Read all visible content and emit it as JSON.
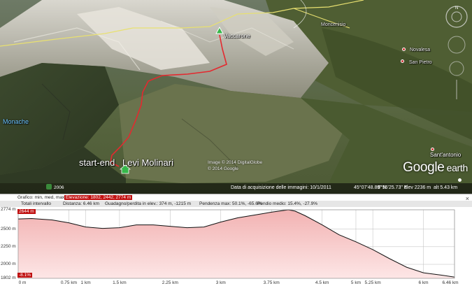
{
  "map": {
    "labels": {
      "moncenisio": "Moncenisio",
      "vaccarone": "Vaccarone",
      "novalesa": "Novalesa",
      "san_pietro": "San Pietro",
      "monache": "Monache",
      "sant_antonio": "Sant'antonio",
      "start_end": "start-end",
      "levi_molinari": "Levi Molinari"
    },
    "copyright": [
      "Image © 2014 DigitalGlobe",
      "© 2014 Google"
    ],
    "logo": {
      "google": "Google",
      "earth": "earth"
    },
    "year": "2006",
    "status": {
      "acquisition": "Data di acquisizione delle immagini: 10/1/2011",
      "lat": "45°07'48.89\" N",
      "lon": "6°55'25.73\" E",
      "elev": "elev  2236 m",
      "alt": "alt  5.43 km"
    },
    "colors": {
      "track": "#e4292f",
      "border": "#e8e070",
      "marker": "#36b84a"
    }
  },
  "profile": {
    "header": {
      "graph_label": "Grafico: min, med, max",
      "elevation_label": "Elevazione: 1802, 2442, 2774 m",
      "close": "×"
    },
    "stats": {
      "totals": "Totali intervallo",
      "distance": "Distanza: 6.46 km",
      "gain": "Guadagno/perdita in elev.: 374 m, -1215 m",
      "slope_max": "Pendenza max: 50.1%, -65.6%",
      "slope_avg": "Pendio medio: 15.4%, -27.9%"
    },
    "cursor_tags": {
      "top": "2644 m",
      "bottom": "-8.1%"
    }
  },
  "chart_data": {
    "type": "area",
    "title": "",
    "xlabel": "",
    "ylabel": "",
    "x_unit": "km",
    "y_unit": "m",
    "xlim": [
      0,
      6.46
    ],
    "ylim": [
      1802,
      2774
    ],
    "ytick_labels": [
      "2774 m",
      "2500 m",
      "2250 m",
      "2000 m",
      "1802 m"
    ],
    "ytick_values": [
      2774,
      2500,
      2250,
      2000,
      1802
    ],
    "xtick_labels": [
      "0 m",
      "0.75 km",
      "1 km",
      "1.5 km",
      "2.25 km",
      "3 km",
      "3.75 km",
      "4.5 km",
      "5 km",
      "5.25 km",
      "6 km",
      "6.46 km"
    ],
    "xtick_values": [
      0,
      0.75,
      1,
      1.5,
      2.25,
      3,
      3.75,
      4.5,
      5,
      5.25,
      6,
      6.46
    ],
    "series": [
      {
        "x": [
          0,
          0.2,
          0.5,
          0.75,
          1.0,
          1.25,
          1.5,
          1.75,
          2.0,
          2.25,
          2.5,
          2.75,
          3.0,
          3.25,
          3.5,
          3.75,
          3.9,
          4.0,
          4.1,
          4.25,
          4.5,
          4.75,
          5.0,
          5.25,
          5.5,
          5.75,
          6.0,
          6.25,
          6.46
        ],
        "y": [
          2644,
          2650,
          2630,
          2590,
          2530,
          2510,
          2520,
          2560,
          2560,
          2540,
          2520,
          2530,
          2600,
          2660,
          2700,
          2740,
          2760,
          2774,
          2755,
          2690,
          2560,
          2420,
          2320,
          2210,
          2080,
          1960,
          1880,
          1850,
          1820
        ]
      }
    ],
    "colors": {
      "line": "#111111",
      "fill_top": "#f2b2b2",
      "fill_bottom": "#fde6e6",
      "grid": "#bbbbbb"
    },
    "grid": true,
    "legend": "none"
  }
}
